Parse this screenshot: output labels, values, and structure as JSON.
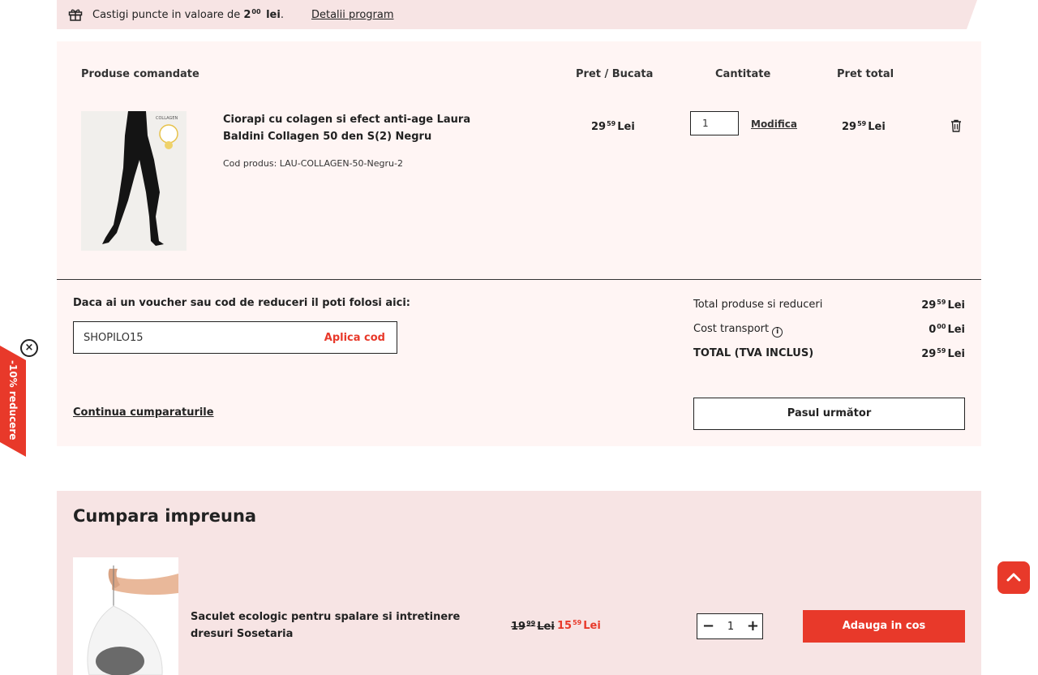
{
  "banner": {
    "text_before": "Castigi puncte in valoare de ",
    "points_int": "2",
    "points_dec": "00",
    "points_unit": "lei",
    "text_after": ".",
    "link": "Detalii program",
    "icon": "gift-icon"
  },
  "cart": {
    "headers": {
      "products": "Produse comandate",
      "unit_price": "Pret / Bucata",
      "quantity": "Cantitate",
      "total_price": "Pret total"
    },
    "item": {
      "name": "Ciorapi cu colagen si efect anti-age Laura Baldini Collagen 50 den S(2) Negru",
      "code": "Cod produs: LAU-COLLAGEN-50-Negru-2",
      "image_badge": "COLLAGEN",
      "unit_price_int": "29",
      "unit_price_dec": "59",
      "currency": "Lei",
      "quantity": "1",
      "modify": "Modifica",
      "total_int": "29",
      "total_dec": "59",
      "delete_icon": "trash-icon"
    },
    "voucher": {
      "label": "Daca ai un voucher sau cod de reduceri il poti folosi aici:",
      "value": "SHOPILO15",
      "apply": "Aplica cod"
    },
    "continue": "Continua cumparaturile",
    "summary": {
      "products_label": "Total produse si reduceri",
      "products_int": "29",
      "products_dec": "59",
      "transport_label": "Cost transport",
      "transport_int": "0",
      "transport_dec": "00",
      "total_label": "TOTAL (TVA INCLUS)",
      "total_int": "29",
      "total_dec": "59",
      "currency": "Lei"
    },
    "next_button": "Pasul următor"
  },
  "promo": {
    "label": "-10% reducere",
    "close": "×"
  },
  "together": {
    "title": "Cumpara impreuna",
    "item": {
      "name": "Saculet ecologic pentru spalare si intretinere dresuri Sosetaria",
      "old_int": "19",
      "old_dec": "99",
      "new_int": "15",
      "new_dec": "59",
      "currency": "Lei",
      "quantity": "1",
      "minus": "−",
      "plus": "+",
      "add_button": "Adauga in cos"
    }
  },
  "colors": {
    "accent": "#e8392a",
    "banner_bg": "#f7e4e4",
    "cart_bg": "#fff5f4"
  }
}
